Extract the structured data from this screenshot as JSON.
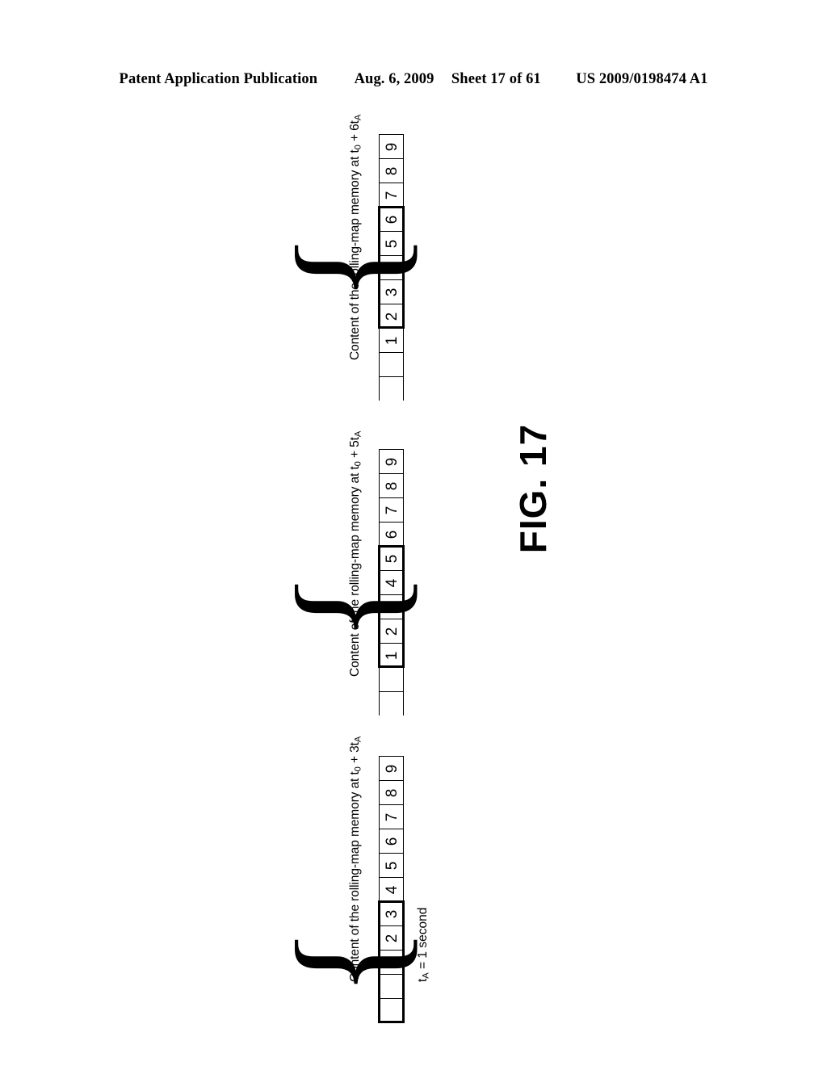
{
  "header": {
    "publication": "Patent Application Publication",
    "date": "Aug. 6, 2009",
    "sheet": "Sheet 17 of 61",
    "patent_number": "US 2009/0198474 A1"
  },
  "figure": {
    "label": "FIG. 17"
  },
  "annotation": {
    "ta_prefix": "t",
    "ta_sub": "A",
    "ta_value": " = 1 second",
    "ta_full": "tA = 1 second"
  },
  "brace_glyph": "{",
  "diagrams": [
    {
      "id": "diagram-t0-plus-6ta",
      "title_prefix": "Content of the rolling-map memory at t",
      "title_sub1": "0",
      "title_mid": " + 6t",
      "title_sub2": "A",
      "title_full": "Content of the rolling-map memory at t0 + 6tA",
      "cells": [
        "9",
        "8",
        "7",
        "6",
        "5",
        "4",
        "3",
        "2",
        "1",
        "",
        ""
      ],
      "group_start_index": 3,
      "group_end_index": 7,
      "group_cells": [
        "6",
        "5",
        "4",
        "3",
        "2"
      ]
    },
    {
      "id": "diagram-t0-plus-5ta",
      "title_prefix": "Content of the rolling-map memory at t",
      "title_sub1": "0",
      "title_mid": " + 5t",
      "title_sub2": "A",
      "title_full": "Content of the rolling-map memory at t0 + 5tA",
      "cells": [
        "9",
        "8",
        "7",
        "6",
        "5",
        "4",
        "3",
        "2",
        "1",
        "",
        ""
      ],
      "group_start_index": 4,
      "group_end_index": 8,
      "group_cells": [
        "5",
        "4",
        "3",
        "2",
        "1"
      ]
    },
    {
      "id": "diagram-t0-plus-3ta",
      "title_prefix": "Content of the rolling-map memory at t",
      "title_sub1": "0",
      "title_mid": " + 3t",
      "title_sub2": "A",
      "title_full": "Content of the rolling-map memory at t0 + 3tA",
      "cells": [
        "9",
        "8",
        "7",
        "6",
        "5",
        "4",
        "3",
        "2",
        "1",
        "",
        ""
      ],
      "group_start_index": 6,
      "group_end_index": 10,
      "group_cells": [
        "3",
        "2",
        "1",
        "",
        ""
      ]
    }
  ]
}
